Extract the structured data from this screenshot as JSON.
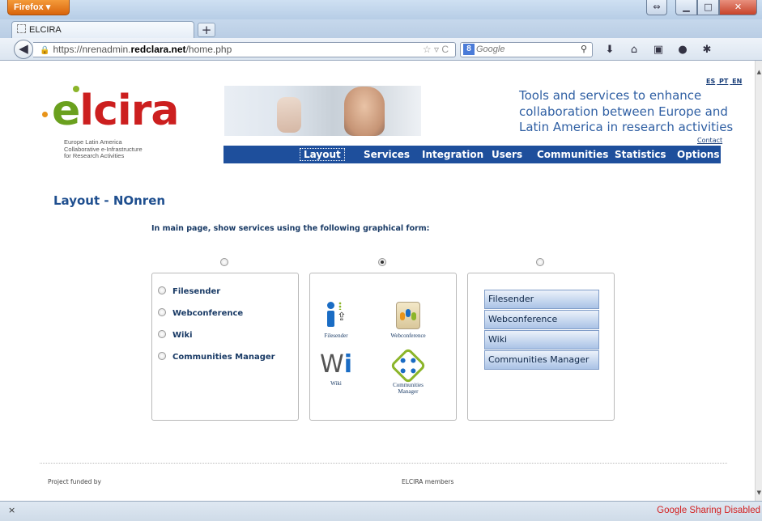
{
  "browser": {
    "menu_button": "Firefox ▾",
    "tab_title": "ELCIRA",
    "new_tab": "+",
    "url_prefix": "https://nrenadmin.",
    "url_domain": "redclara.net",
    "url_path": "/home.php",
    "search_placeholder": "Google",
    "search_engine_letter": "8",
    "status_message": "Google Sharing Disabled",
    "status_close": "×"
  },
  "site": {
    "languages": [
      "ES",
      "PT",
      "EN"
    ],
    "logo_word_prefix": "e",
    "logo_word_rest": "lcira",
    "logo_subtitle_lines": [
      "Europe Latin America",
      "Collaborative e-Infrastructure",
      "for Research Activities"
    ],
    "tagline_lines": [
      "Tools and services to enhance",
      "collaboration between Europe and",
      "Latin America in research activities"
    ],
    "contact": "Contact",
    "menu": [
      "Layout",
      "Services",
      "Integration",
      "Users",
      "Communities",
      "Statistics",
      "Options"
    ],
    "active_menu": "Layout"
  },
  "main": {
    "title": "Layout - NOnren",
    "prompt": "In main page, show services using the following graphical form:",
    "selected_layout": 2,
    "list_options": [
      "Filesender",
      "Webconference",
      "Wiki",
      "Communities Manager"
    ],
    "icon_labels": [
      "Filesender",
      "Webconference",
      "Wiki",
      "Communities Manager"
    ],
    "button_options": [
      "Filesender",
      "Webconference",
      "Wiki",
      "Communities Manager"
    ]
  },
  "footer": {
    "funded": "Project funded by",
    "members": "ELCIRA members"
  },
  "colors": {
    "menu_bg": "#1e4f9c",
    "title_blue": "#1f4f8f",
    "logo_red": "#cc1f1f",
    "logo_green": "#6aa01e",
    "status_red": "#d32222"
  }
}
